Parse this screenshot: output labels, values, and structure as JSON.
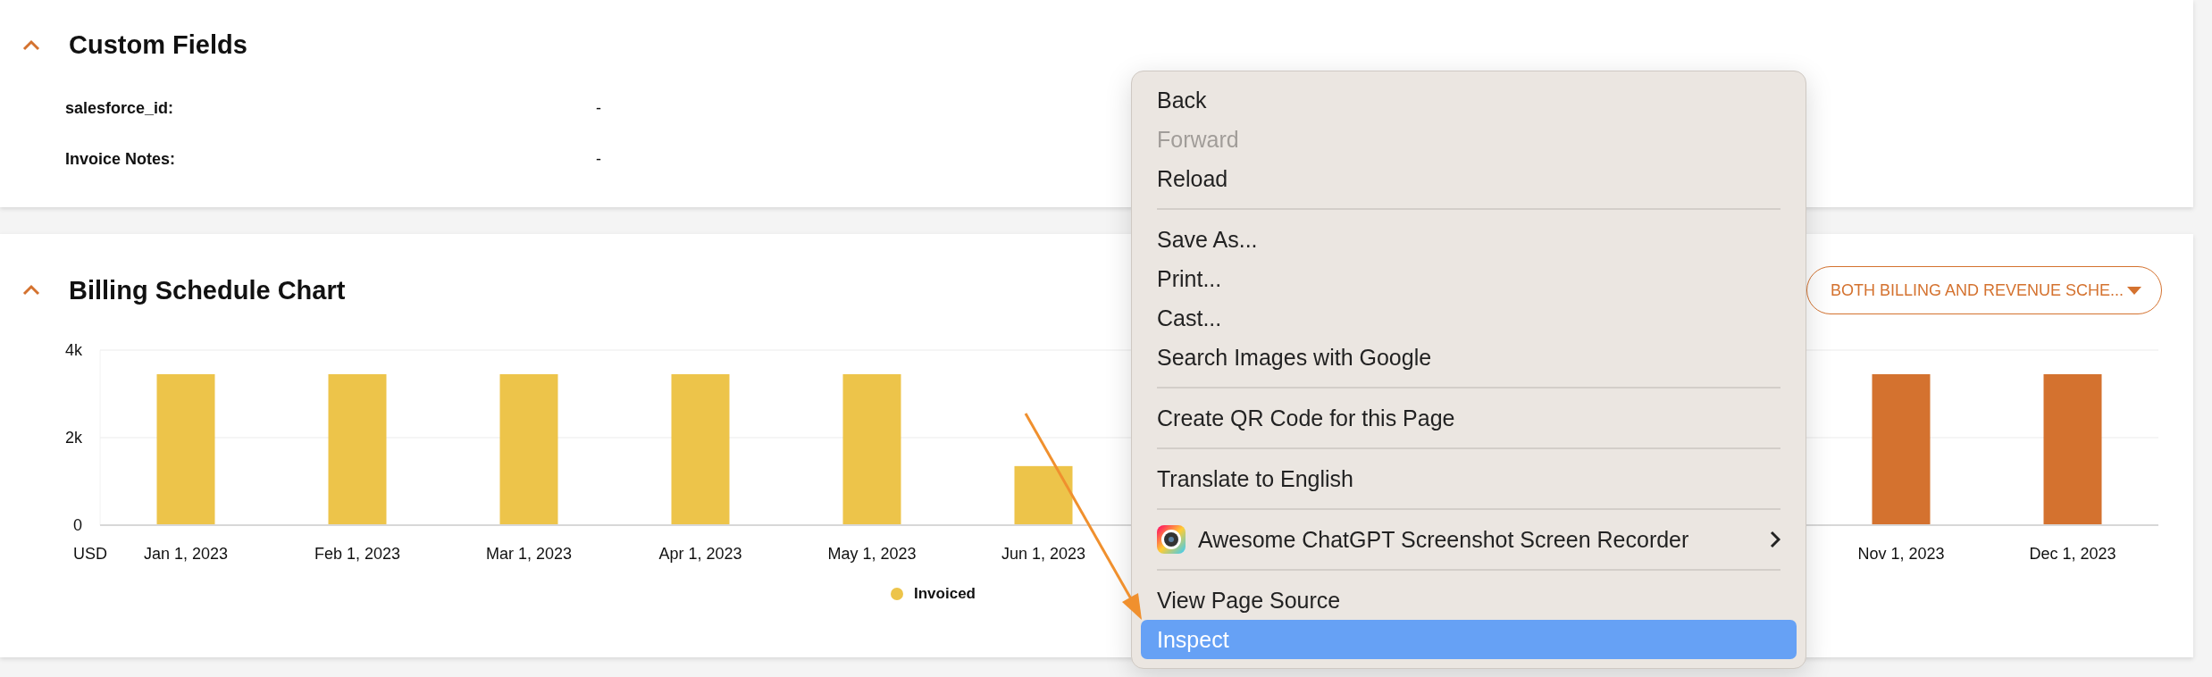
{
  "custom_fields": {
    "title": "Custom Fields",
    "expanded": true,
    "fields": [
      {
        "label": "salesforce_id:",
        "value": "-"
      },
      {
        "label": "Invoice Notes:",
        "value": "-"
      }
    ]
  },
  "billing_schedule": {
    "title": "Billing Schedule Chart",
    "expanded": true,
    "dropdown": "BOTH BILLING AND REVENUE SCHE...",
    "chart_data": {
      "type": "bar",
      "ylabel": "USD",
      "categories": [
        "Jan 1, 2023",
        "Feb 1, 2023",
        "Mar 1, 2023",
        "Apr 1, 2023",
        "May 1, 2023",
        "Jun 1, 2023",
        null,
        null,
        null,
        null,
        "Nov 1, 2023",
        "Dec 1, 2023"
      ],
      "series": [
        {
          "name": "Invoiced",
          "color": "#edc44a",
          "values": [
            3450,
            3450,
            3450,
            3450,
            3450,
            1350,
            null,
            null,
            null,
            null,
            null,
            null
          ]
        },
        {
          "color": "#d4722f",
          "values": [
            null,
            null,
            null,
            null,
            null,
            null,
            null,
            null,
            null,
            null,
            3450,
            3450
          ]
        }
      ],
      "ylim": [
        0,
        4000
      ],
      "yticks": [
        {
          "value": 0,
          "label": "0"
        },
        {
          "value": 2000,
          "label": "2k"
        },
        {
          "value": 4000,
          "label": "4k"
        }
      ]
    }
  },
  "context_menu": {
    "items": [
      {
        "kind": "item",
        "label": "Back",
        "disabled": false,
        "selected": false
      },
      {
        "kind": "item",
        "label": "Forward",
        "disabled": true,
        "selected": false
      },
      {
        "kind": "item",
        "label": "Reload",
        "disabled": false,
        "selected": false
      },
      {
        "kind": "separator"
      },
      {
        "kind": "item",
        "label": "Save As...",
        "disabled": false,
        "selected": false
      },
      {
        "kind": "item",
        "label": "Print...",
        "disabled": false,
        "selected": false
      },
      {
        "kind": "item",
        "label": "Cast...",
        "disabled": false,
        "selected": false
      },
      {
        "kind": "item",
        "label": "Search Images with Google",
        "disabled": false,
        "selected": false
      },
      {
        "kind": "separator"
      },
      {
        "kind": "item",
        "label": "Create QR Code for this Page",
        "disabled": false,
        "selected": false
      },
      {
        "kind": "separator"
      },
      {
        "kind": "item",
        "label": "Translate to English",
        "disabled": false,
        "selected": false
      },
      {
        "kind": "separator"
      },
      {
        "kind": "submenu",
        "label": "Awesome ChatGPT Screenshot  Screen Recorder",
        "disabled": false,
        "selected": false
      },
      {
        "kind": "separator"
      },
      {
        "kind": "item",
        "label": "View Page Source",
        "disabled": false,
        "selected": false
      },
      {
        "kind": "item",
        "label": "Inspect",
        "disabled": false,
        "selected": true
      }
    ]
  }
}
